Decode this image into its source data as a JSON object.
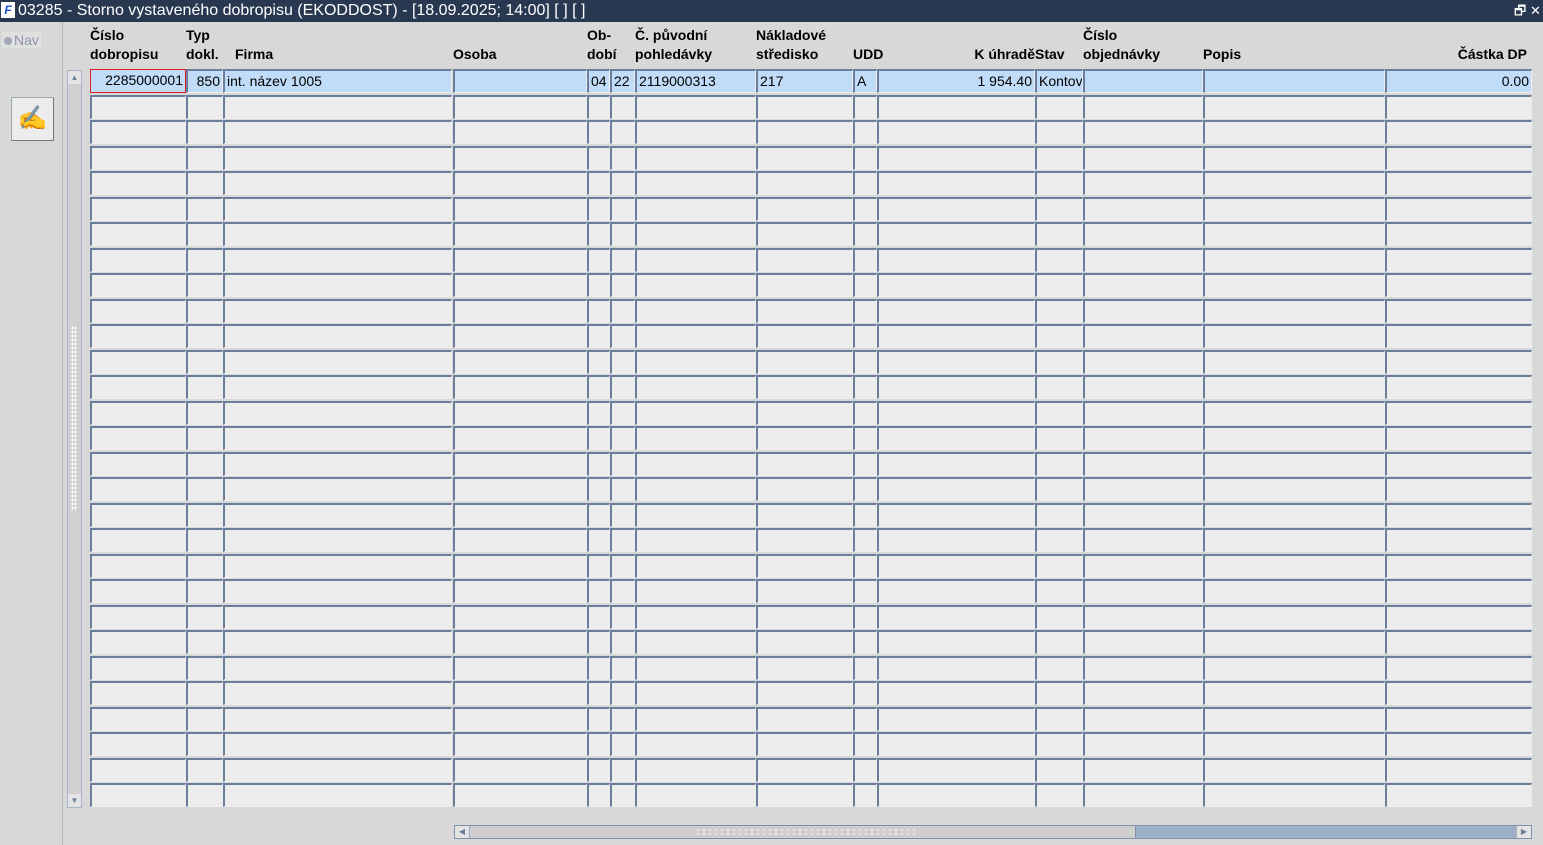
{
  "window": {
    "title": "03285 - Storno vystaveného dobropisu (EKODDOST) - [18.09.2025; 14:00]  [ ]  [ ]",
    "icon": "app-logo-icon",
    "restore": "🗗",
    "close": "✕"
  },
  "left": {
    "nav_label": "Nav",
    "tool_icon": "hand-pen-icon",
    "tool_glyph": "✍"
  },
  "colors": {
    "selected_row": "#c0dcf8",
    "cell": "#ececec",
    "titlebar": "#283850",
    "focus": "#e02020"
  },
  "columns": [
    {
      "l1": "Číslo",
      "l2": "dobropisu"
    },
    {
      "l1": "Typ",
      "l2": "dokl."
    },
    {
      "l1": "",
      "l2": "Firma"
    },
    {
      "l1": "",
      "l2": "Osoba"
    },
    {
      "l1": "Ob-",
      "l2": "dobí"
    },
    {
      "l1": "",
      "l2": ""
    },
    {
      "l1": "Č. původní",
      "l2": "pohledávky"
    },
    {
      "l1": "Nákladové",
      "l2": "středisko"
    },
    {
      "l1": "",
      "l2": "UDD"
    },
    {
      "l1": "",
      "l2": "K úhradě"
    },
    {
      "l1": "",
      "l2": "Stav"
    },
    {
      "l1": "Číslo",
      "l2": "objednávky"
    },
    {
      "l1": "",
      "l2": "Popis"
    },
    {
      "l1": "",
      "l2": "Částka DP"
    }
  ],
  "rows": [
    [
      "2285000001",
      "850",
      "int. název 1005",
      "",
      "04",
      "22",
      "2119000313",
      "217",
      "A",
      "1 954.40",
      "Kontov",
      "",
      "",
      "0.00"
    ]
  ]
}
